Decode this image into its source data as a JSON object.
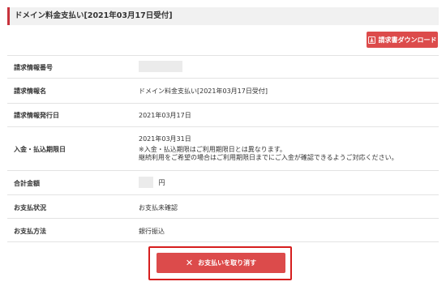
{
  "title": "ドメイン料金支払い[2021年03月17日受付]",
  "download_button": {
    "icon": "download-icon",
    "label": "請求書ダウンロード"
  },
  "rows": [
    {
      "label": "請求情報番号",
      "value": ""
    },
    {
      "label": "請求情報名",
      "value": "ドメイン料金支払い[2021年03月17日受付]"
    },
    {
      "label": "請求情報発行日",
      "value": "2021年03月17日"
    },
    {
      "label": "入金・払込期限日",
      "value": "2021年03月31日",
      "notes": [
        "※入金・払込期限はご利用期限日とは異なります。",
        "継続利用をご希望の場合はご利用期限日までにご入金が確認できるようご対応ください。"
      ]
    },
    {
      "label": "合計金額",
      "value": "円"
    },
    {
      "label": "お支払状況",
      "value": "お支払未確認"
    },
    {
      "label": "お支払方法",
      "value": "銀行振込"
    }
  ],
  "cancel_button": {
    "icon": "close-icon",
    "label": "お支払いを取り消す"
  },
  "colors": {
    "accent": "#dc4b4b",
    "highlight_border": "#d61e1e",
    "title_bar": "#f1f1f1"
  }
}
